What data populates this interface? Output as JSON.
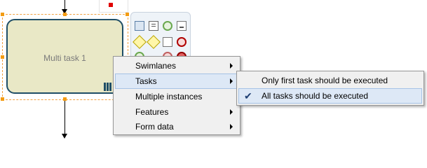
{
  "canvas": {
    "task": {
      "label": "Multi task 1"
    }
  },
  "palette": {
    "icons": [
      "swimlane-icon",
      "annotation-icon",
      "end-event-icon",
      "data-store-icon",
      "parallel-gateway-icon",
      "exclusive-gateway-icon",
      "inclusive-gateway-icon",
      "error-end-event-icon"
    ]
  },
  "context_menu": {
    "items": [
      {
        "label": "Swimlanes",
        "has_submenu": true
      },
      {
        "label": "Tasks",
        "has_submenu": true
      },
      {
        "label": "Multiple instances",
        "has_submenu": false
      },
      {
        "label": "Features",
        "has_submenu": true
      },
      {
        "label": "Form data",
        "has_submenu": true
      }
    ],
    "hovered": "Tasks"
  },
  "submenu": {
    "items": [
      {
        "label": "Only first task should be executed",
        "checked": false
      },
      {
        "label": "All tasks should be executed",
        "checked": true
      }
    ]
  },
  "colors": {
    "task_fill": "#e9e8c6",
    "task_border": "#1f4e66",
    "selection_handle": "#f39c12",
    "menu_highlight": "#dde8f6"
  }
}
